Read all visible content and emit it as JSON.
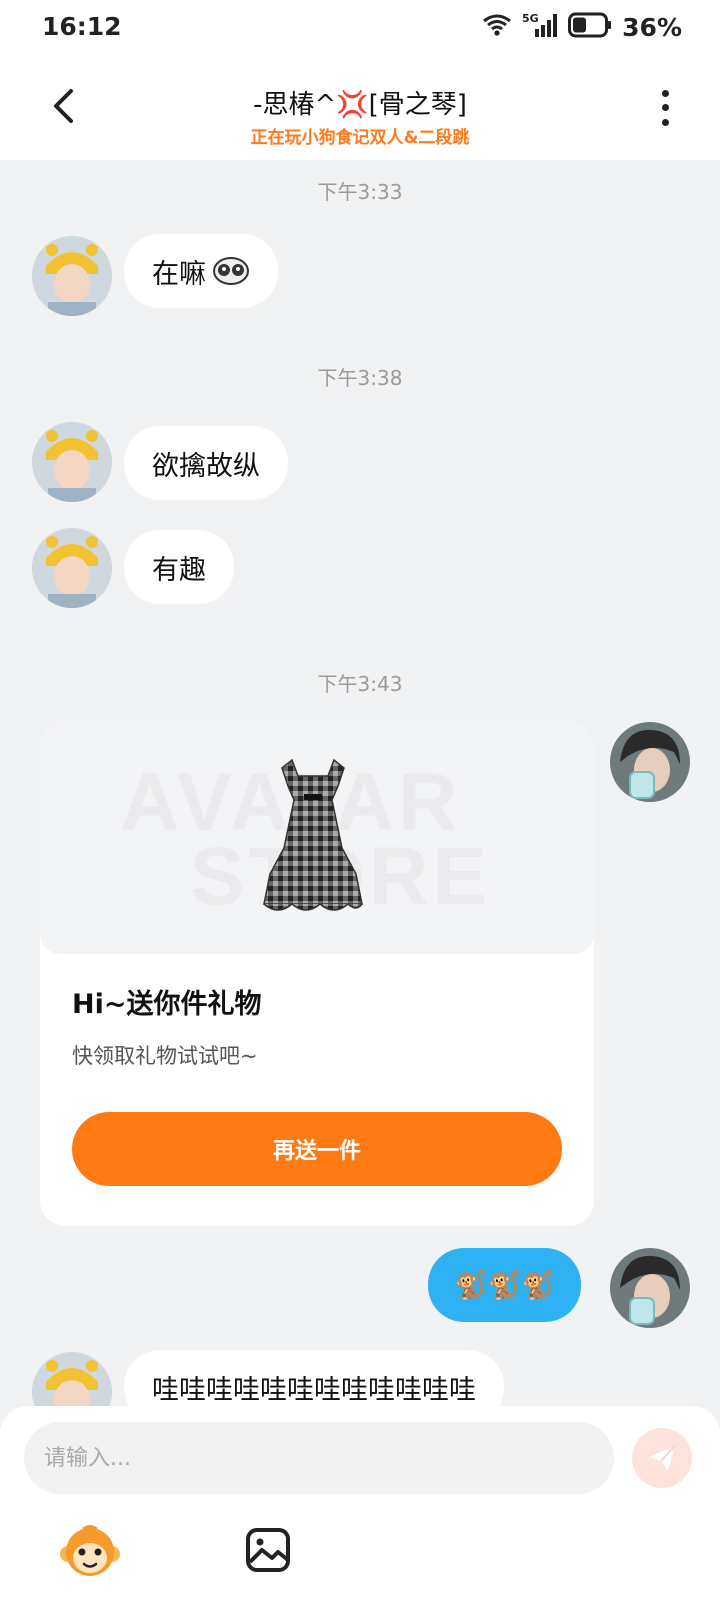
{
  "status": {
    "time": "16:12",
    "network": "5G",
    "battery": "36%"
  },
  "header": {
    "title_prefix": "-思椿^",
    "title_suffix": "[骨之琴]",
    "subtitle": "正在玩小狗食记双人&二段跳"
  },
  "messages": {
    "ts1": "下午3:33",
    "m1": "在嘛",
    "ts2": "下午3:38",
    "m2": "欲擒故纵",
    "m3": "有趣",
    "ts3": "下午3:43",
    "gift": {
      "watermark_line1": "AVATAR",
      "watermark_line2": "STORE",
      "title": "Hi~送你件礼物",
      "desc": "快领取礼物试试吧~",
      "button": "再送一件"
    },
    "m5": "🐒🐒🐒",
    "m6": "哇哇哇哇哇哇哇哇哇哇哇哇"
  },
  "input": {
    "placeholder": "请输入..."
  },
  "colors": {
    "accent": "#ff7a12",
    "subtitle": "#ff7a1a",
    "blue_bubble": "#2fb2f3"
  }
}
